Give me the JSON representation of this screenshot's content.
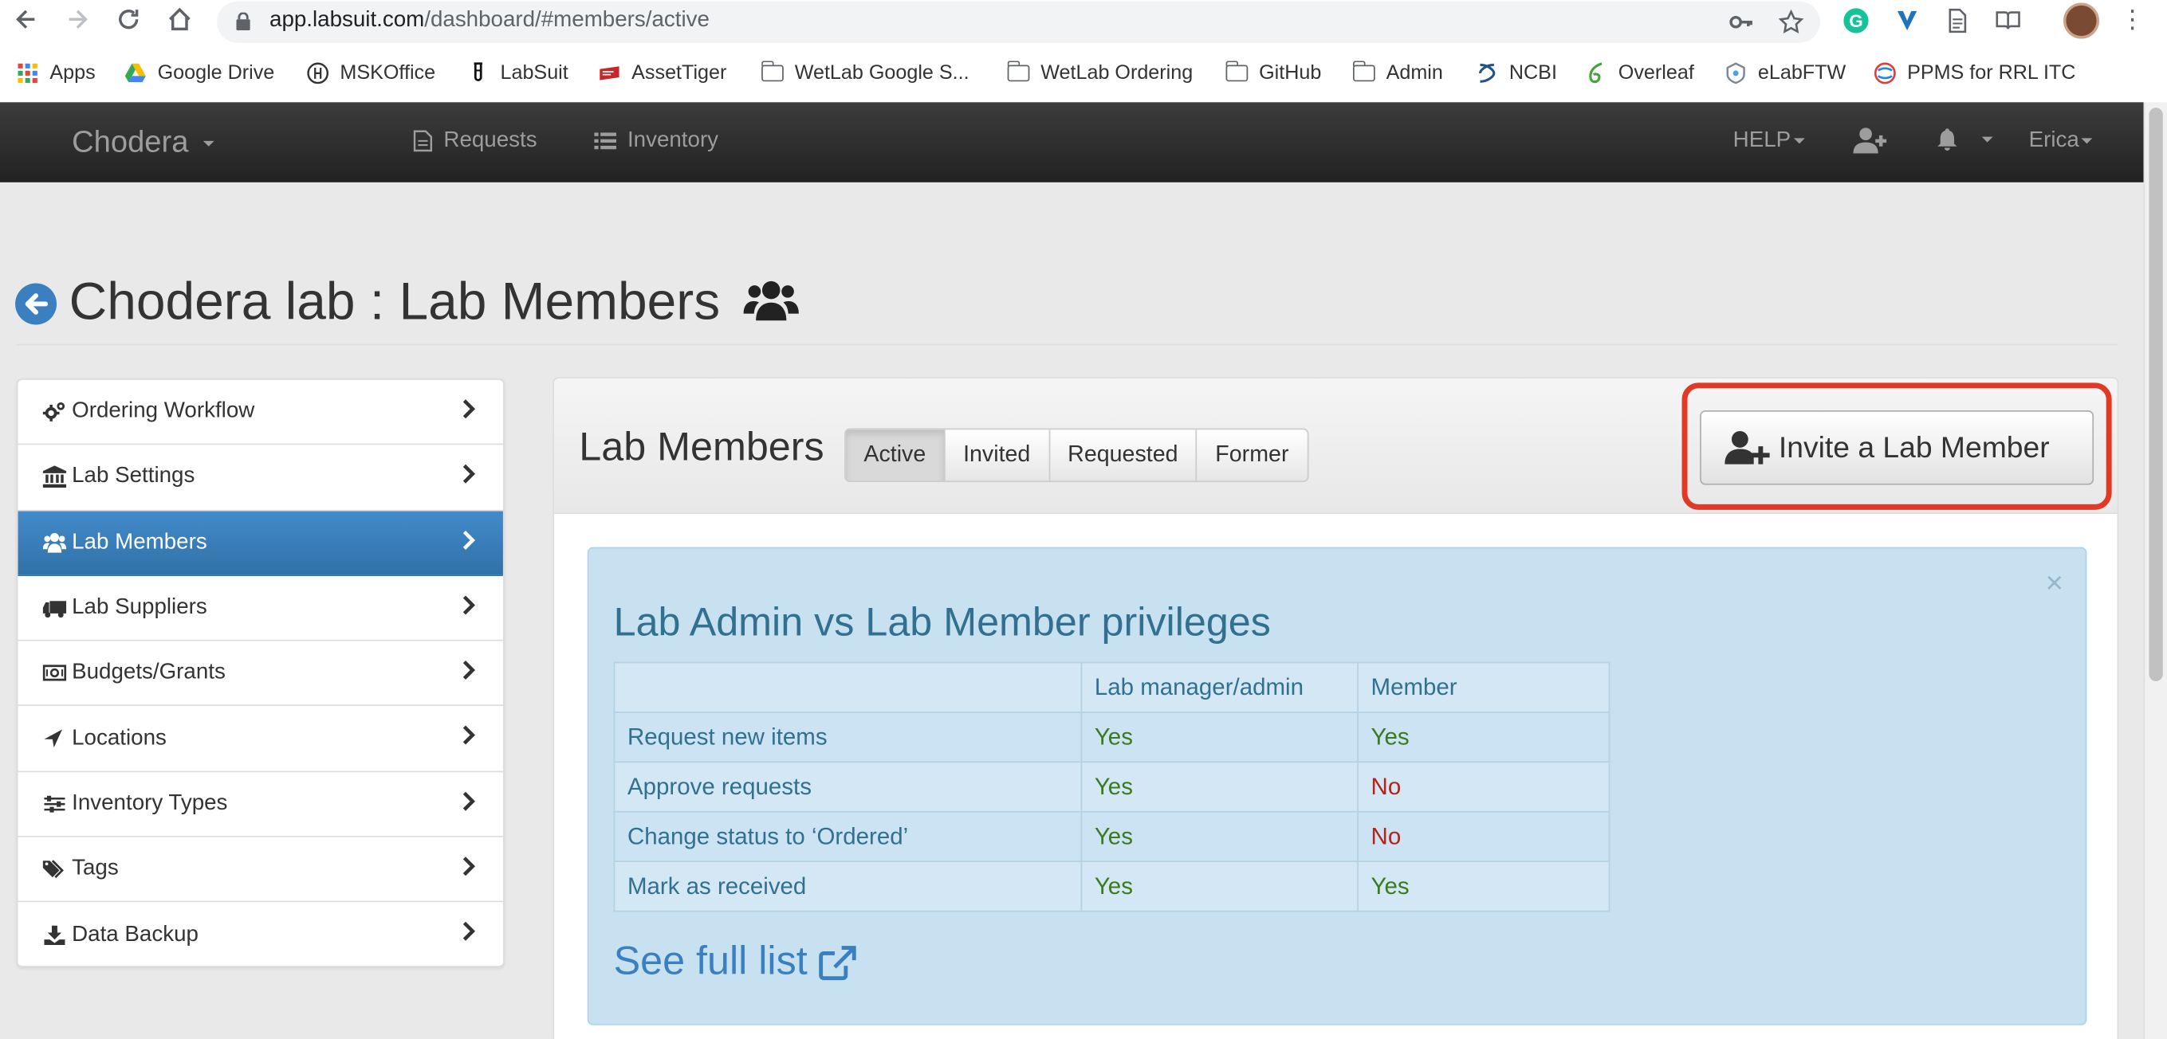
{
  "browser": {
    "url_host": "app.labsuit.com",
    "url_path": "/dashboard/#members/active"
  },
  "bookmarks": [
    {
      "label": "Apps",
      "icon": "apps-grid-icon"
    },
    {
      "label": "Google Drive",
      "icon": "google-drive-icon"
    },
    {
      "label": "MSKOffice",
      "icon": "mskoffice-icon"
    },
    {
      "label": "LabSuit",
      "icon": "labsuit-icon"
    },
    {
      "label": "AssetTiger",
      "icon": "assettiger-icon"
    },
    {
      "label": "WetLab Google S...",
      "icon": "folder-icon"
    },
    {
      "label": "WetLab Ordering",
      "icon": "folder-icon"
    },
    {
      "label": "GitHub",
      "icon": "folder-icon"
    },
    {
      "label": "Admin",
      "icon": "folder-icon"
    },
    {
      "label": "NCBI",
      "icon": "ncbi-icon"
    },
    {
      "label": "Overleaf",
      "icon": "overleaf-icon"
    },
    {
      "label": "eLabFTW",
      "icon": "elabftw-icon"
    },
    {
      "label": "PPMS for RRL ITC",
      "icon": "ppms-icon"
    }
  ],
  "navbar": {
    "brand": "Chodera",
    "links": [
      {
        "label": "Requests",
        "icon": "document-icon"
      },
      {
        "label": "Inventory",
        "icon": "list-icon"
      }
    ],
    "help": "HELP",
    "user": "Erica"
  },
  "page": {
    "title": "Chodera lab : Lab Members"
  },
  "sidebar": {
    "items": [
      {
        "label": "Ordering Workflow",
        "icon": "cogs-icon",
        "active": false
      },
      {
        "label": "Lab Settings",
        "icon": "bank-icon",
        "active": false
      },
      {
        "label": "Lab Members",
        "icon": "users-icon",
        "active": true
      },
      {
        "label": "Lab Suppliers",
        "icon": "truck-icon",
        "active": false
      },
      {
        "label": "Budgets/Grants",
        "icon": "money-icon",
        "active": false
      },
      {
        "label": "Locations",
        "icon": "location-arrow-icon",
        "active": false
      },
      {
        "label": "Inventory Types",
        "icon": "sliders-icon",
        "active": false
      },
      {
        "label": "Tags",
        "icon": "tags-icon",
        "active": false
      },
      {
        "label": "Data Backup",
        "icon": "download-icon",
        "active": false
      }
    ]
  },
  "panel": {
    "title": "Lab Members",
    "tabs": [
      {
        "label": "Active",
        "active": true
      },
      {
        "label": "Invited",
        "active": false
      },
      {
        "label": "Requested",
        "active": false
      },
      {
        "label": "Former",
        "active": false
      }
    ],
    "invite_label": "Invite a Lab Member"
  },
  "alert": {
    "close": "×",
    "title": "Lab Admin vs Lab Member privileges",
    "columns": [
      "",
      "Lab manager/admin",
      "Member"
    ],
    "rows": [
      {
        "label": "Request new items",
        "admin": "Yes",
        "member": "Yes"
      },
      {
        "label": "Approve requests",
        "admin": "Yes",
        "member": "No"
      },
      {
        "label": "Change status to ‘Ordered’",
        "admin": "Yes",
        "member": "No"
      },
      {
        "label": "Mark as received",
        "admin": "Yes",
        "member": "Yes"
      }
    ],
    "see_full": "See full list"
  },
  "colors": {
    "navbar_bg": "#222222",
    "active_blue": "#428bca",
    "alert_bg": "#c7e1f1",
    "alert_text": "#31708f",
    "yes": "#3c7a1f",
    "no": "#b52217",
    "highlight_border": "#e03a26"
  }
}
